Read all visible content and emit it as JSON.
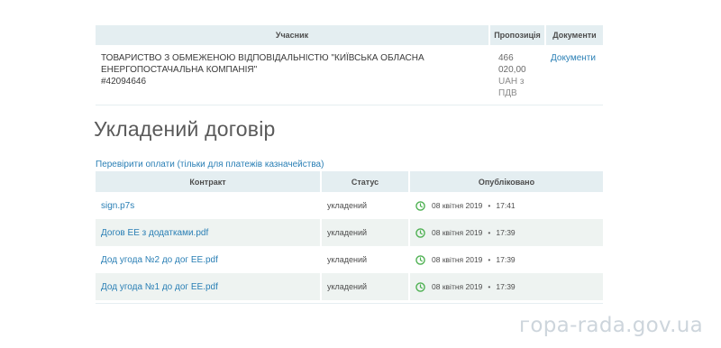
{
  "participants": {
    "headers": {
      "participant": "Учасник",
      "proposal": "Пропозиція",
      "documents": "Документи"
    },
    "rows": [
      {
        "name_line1": "ТОВАРИСТВО З ОБМЕЖЕНОЮ ВІДПОВІДАЛЬНІСТЮ \"КИЇВСЬКА ОБЛАСНА",
        "name_line2": "ЕНЕРГОПОСТАЧАЛЬНА КОМПАНІЯ\"",
        "code": "#42094646",
        "amount": "466 020,00",
        "currency": "UAH з",
        "vat": "ПДВ",
        "documents_link": "Документи"
      }
    ]
  },
  "contract_section": {
    "title": "Укладений договір",
    "check_payments_link": "Перевірити оплати (тільки для платежів казначейства)",
    "headers": {
      "contract": "Контракт",
      "status": "Статус",
      "published": "Опубліковано"
    },
    "rows": [
      {
        "file": "sign.p7s",
        "status": "укладений",
        "date": "08 квітня 2019",
        "time": "17:41"
      },
      {
        "file": "Догов ЕЕ з додатками.pdf",
        "status": "укладений",
        "date": "08 квітня 2019",
        "time": "17:39"
      },
      {
        "file": "Дод угода №2 до дог ЕЕ.pdf",
        "status": "укладений",
        "date": "08 квітня 2019",
        "time": "17:39"
      },
      {
        "file": "Дод угода №1 до дог ЕЕ.pdf",
        "status": "укладений",
        "date": "08 квітня 2019",
        "time": "17:39"
      }
    ],
    "bullet": "•"
  },
  "watermark": "гора-rada.gov.ua",
  "colors": {
    "header_bg": "#e4eef1",
    "stripe": "#eef3f1",
    "link": "#2a7fb5",
    "clock_green": "#4cb050"
  },
  "icons": {
    "published": "clock-icon"
  }
}
